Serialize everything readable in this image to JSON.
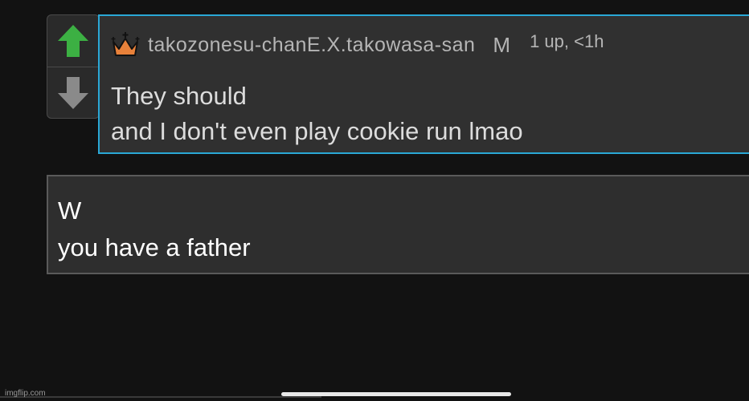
{
  "comment": {
    "username": "takozonesu-chanE.X.takowasa-san",
    "flag": "M",
    "stats": "1 up, <1h",
    "lines": [
      "They should",
      "and I don't even play cookie run lmao"
    ]
  },
  "reply": {
    "lines": [
      "W",
      "you have a father"
    ]
  },
  "icons": {
    "badge": "crown-icon",
    "upvote": "up-arrow-icon",
    "downvote": "down-arrow-icon"
  },
  "colors": {
    "upvote_active": "#3cb043",
    "downvote": "#8a8a8a",
    "highlight_border": "#2aa8d6",
    "crown": "#e8813a"
  },
  "watermark": "imgflip.com"
}
